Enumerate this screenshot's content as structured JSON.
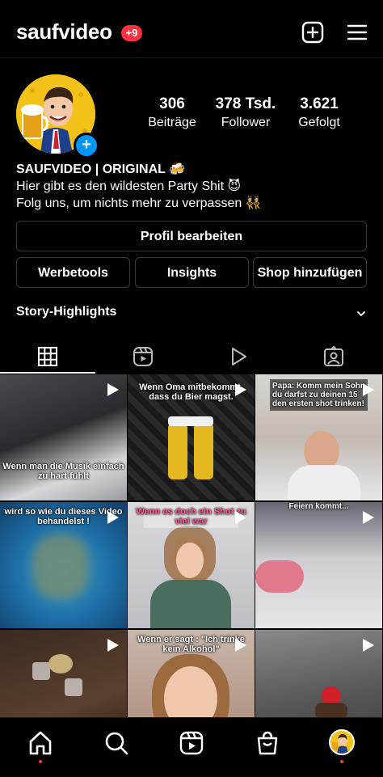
{
  "header": {
    "username": "saufvideo",
    "notifications": "+9"
  },
  "profile": {
    "stats": [
      {
        "value": "306",
        "label": "Beiträge"
      },
      {
        "value": "378 Tsd.",
        "label": "Follower"
      },
      {
        "value": "3.621",
        "label": "Gefolgt"
      }
    ],
    "bio": {
      "name": "SAUFVIDEO | ORIGINAL 🍻",
      "line1": "Hier gibt es den wildesten Party Shit 😈",
      "line2": "Folg uns, um nichts mehr zu verpassen 👯"
    }
  },
  "buttons": {
    "edit": "Profil bearbeiten",
    "tools": "Werbetools",
    "insights": "Insights",
    "shop": "Shop hinzufügen"
  },
  "highlights": {
    "label": "Story-Highlights"
  },
  "tabs": [
    "grid",
    "reels",
    "videos",
    "tagged"
  ],
  "posts": [
    {
      "caption": "Wenn man die Musik einfach zu hart fühlt"
    },
    {
      "caption": "Wenn Oma mitbekommt, dass du Bier magst."
    },
    {
      "caption": "Papa: Komm mein Sohn du darfst zu deinen 15 den ersten shot trinken!"
    },
    {
      "caption": "wird so wie du dieses Video behandelst !"
    },
    {
      "caption": "Wenn es doch ein Shot zu viel war"
    },
    {
      "caption": "Feiern kommt..."
    },
    {
      "caption": ""
    },
    {
      "caption": "Wenn er sagt : \"Ich trinke kein Alkohol\""
    },
    {
      "caption": ""
    }
  ],
  "colors": {
    "accent": "#0095f6",
    "badge": "#ff3040",
    "background": "#000000"
  }
}
